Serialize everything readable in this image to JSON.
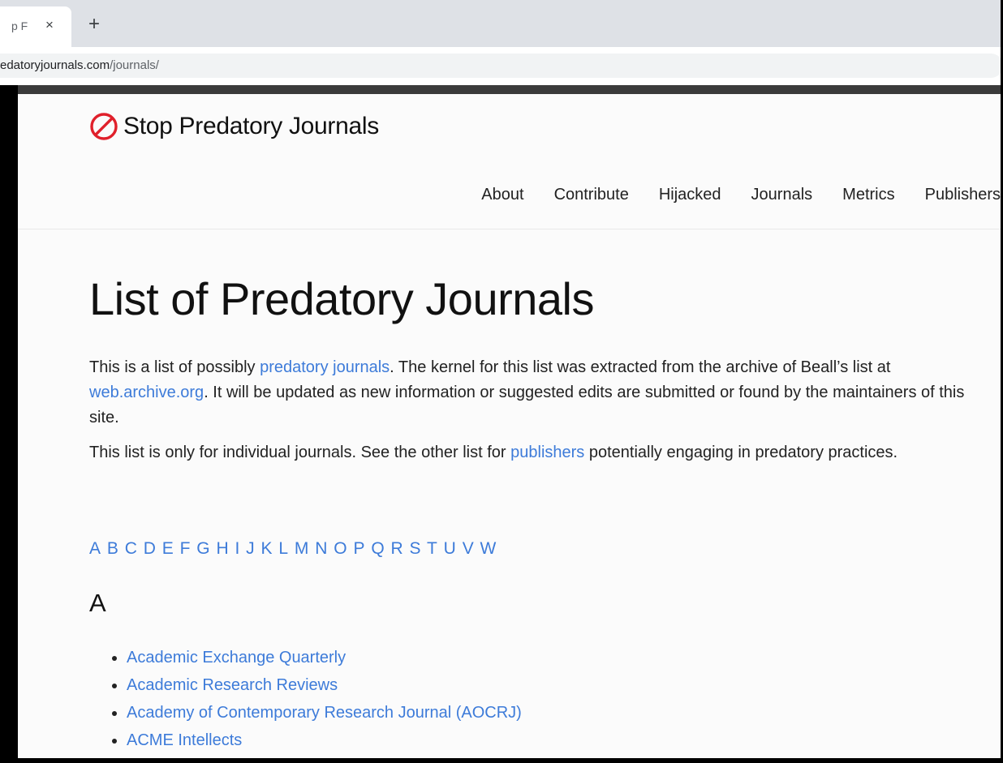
{
  "browser": {
    "tab": {
      "title": "p F",
      "close_glyph": "×"
    },
    "new_tab_glyph": "+",
    "url": {
      "host": "edatoryjournals.com",
      "path": "/journals/"
    }
  },
  "site": {
    "brand": "Stop Predatory Journals",
    "brand_icon": "prohibited-icon",
    "accent_color": "#e0202b",
    "link_color": "#3d7bd9",
    "nav": [
      "About",
      "Contribute",
      "Hijacked",
      "Journals",
      "Metrics",
      "Publishers"
    ]
  },
  "page": {
    "title": "List of Predatory Journals",
    "intro": {
      "t1": "This is a list of possibly ",
      "link1": "predatory journals",
      "t2": ". The kernel for this list was extracted from the archive of Beall’s list at ",
      "link2": "web.archive.org",
      "t3": ". It will be updated as new information or suggested edits are submitted or found by the maintainers of this site."
    },
    "note": {
      "t1": "This list is only for individual journals. See the other list for ",
      "link": "publishers",
      "t2": " potentially engaging in predatory practices."
    },
    "alphabet": [
      "A",
      "B",
      "C",
      "D",
      "E",
      "F",
      "G",
      "H",
      "I",
      "J",
      "K",
      "L",
      "M",
      "N",
      "O",
      "P",
      "Q",
      "R",
      "S",
      "T",
      "U",
      "V",
      "W"
    ],
    "section": {
      "letter": "A",
      "journals": [
        "Academic Exchange Quarterly",
        "Academic Research Reviews",
        "Academy of Contemporary Research Journal (AOCRJ)",
        "ACME Intellects"
      ]
    }
  }
}
